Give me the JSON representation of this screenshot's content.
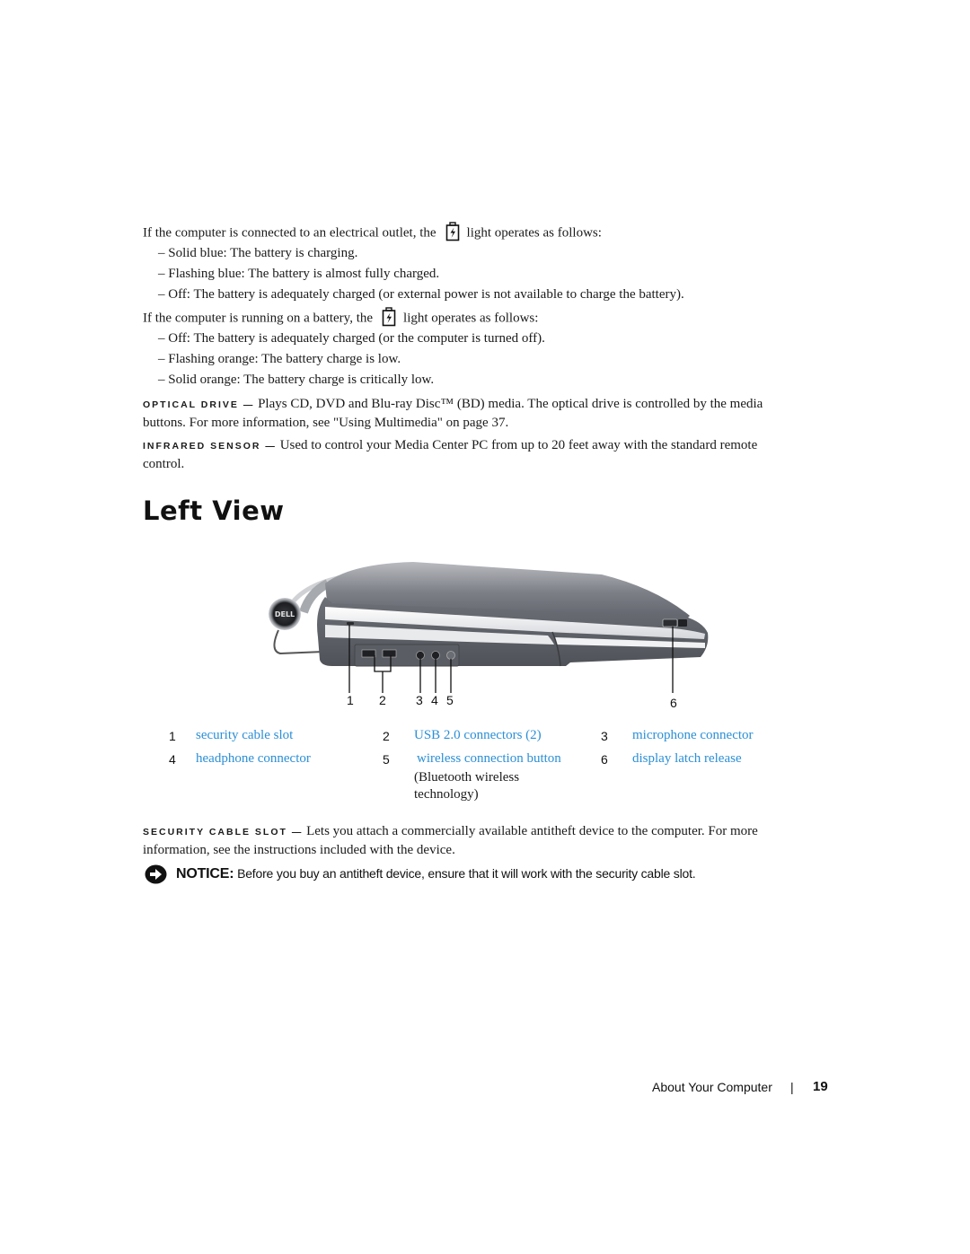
{
  "battery_section": {
    "outlet_intro_before": "If the computer is connected to an electrical outlet, the",
    "outlet_intro_after": "light operates as follows:",
    "outlet_items": [
      "– Solid blue: The battery is charging.",
      "– Flashing blue: The battery is almost fully charged.",
      "– Off: The battery is adequately charged (or external power is not available to charge the battery)."
    ],
    "battery_intro_before": "If the computer is running on a battery, the",
    "battery_intro_after": "light operates as follows:",
    "battery_items": [
      "– Off: The battery is adequately charged (or the computer is turned off).",
      "– Flashing orange: The battery charge is low.",
      "– Solid orange: The battery charge is critically low."
    ],
    "icon": "battery-status-icon"
  },
  "definitions": [
    {
      "term": "OPTICAL DRIVE —",
      "line1": "Plays CD, DVD and Blu-ray Disc™ (BD) media. The optical drive is controlled by the media",
      "line2": "buttons. For more information, see \"Using Multimedia\" on page 37."
    },
    {
      "term": "INFRARED SENSOR —",
      "line1": "Used to control your Media Center PC from up to 20 feet away with the standard remote",
      "line2": "control."
    }
  ],
  "section_title": "Left View",
  "figure": {
    "description": "Left side view of laptop computer",
    "callouts": [
      "1",
      "2",
      "3",
      "4",
      "5",
      "6"
    ],
    "logo_text": "DELL"
  },
  "legend": [
    {
      "num": "1",
      "label": "security cable slot"
    },
    {
      "num": "2",
      "label": "USB 2.0 connectors (2)"
    },
    {
      "num": "3",
      "label": "microphone connector"
    },
    {
      "num": "4",
      "label": "headphone connector"
    },
    {
      "num": "5",
      "label": "wireless connection button",
      "note_line1": "(Bluetooth wireless",
      "note_line2": "technology)"
    },
    {
      "num": "6",
      "label": "display latch release"
    }
  ],
  "security_section": {
    "term": "SECURITY CABLE SLOT —",
    "line1": "Lets you attach a commercially available antitheft device to the computer. For more",
    "line2": "information, see the instructions included with the device."
  },
  "notice": {
    "icon": "notice-arrow-icon",
    "label": "NOTICE:",
    "text": "Before you buy an antitheft device, ensure that it will work with the security cable slot."
  },
  "footer": {
    "chapter": "About Your Computer",
    "separator": "|",
    "page_number": "19"
  },
  "colors": {
    "link": "#2b8fd6",
    "text": "#1a1a1a"
  }
}
